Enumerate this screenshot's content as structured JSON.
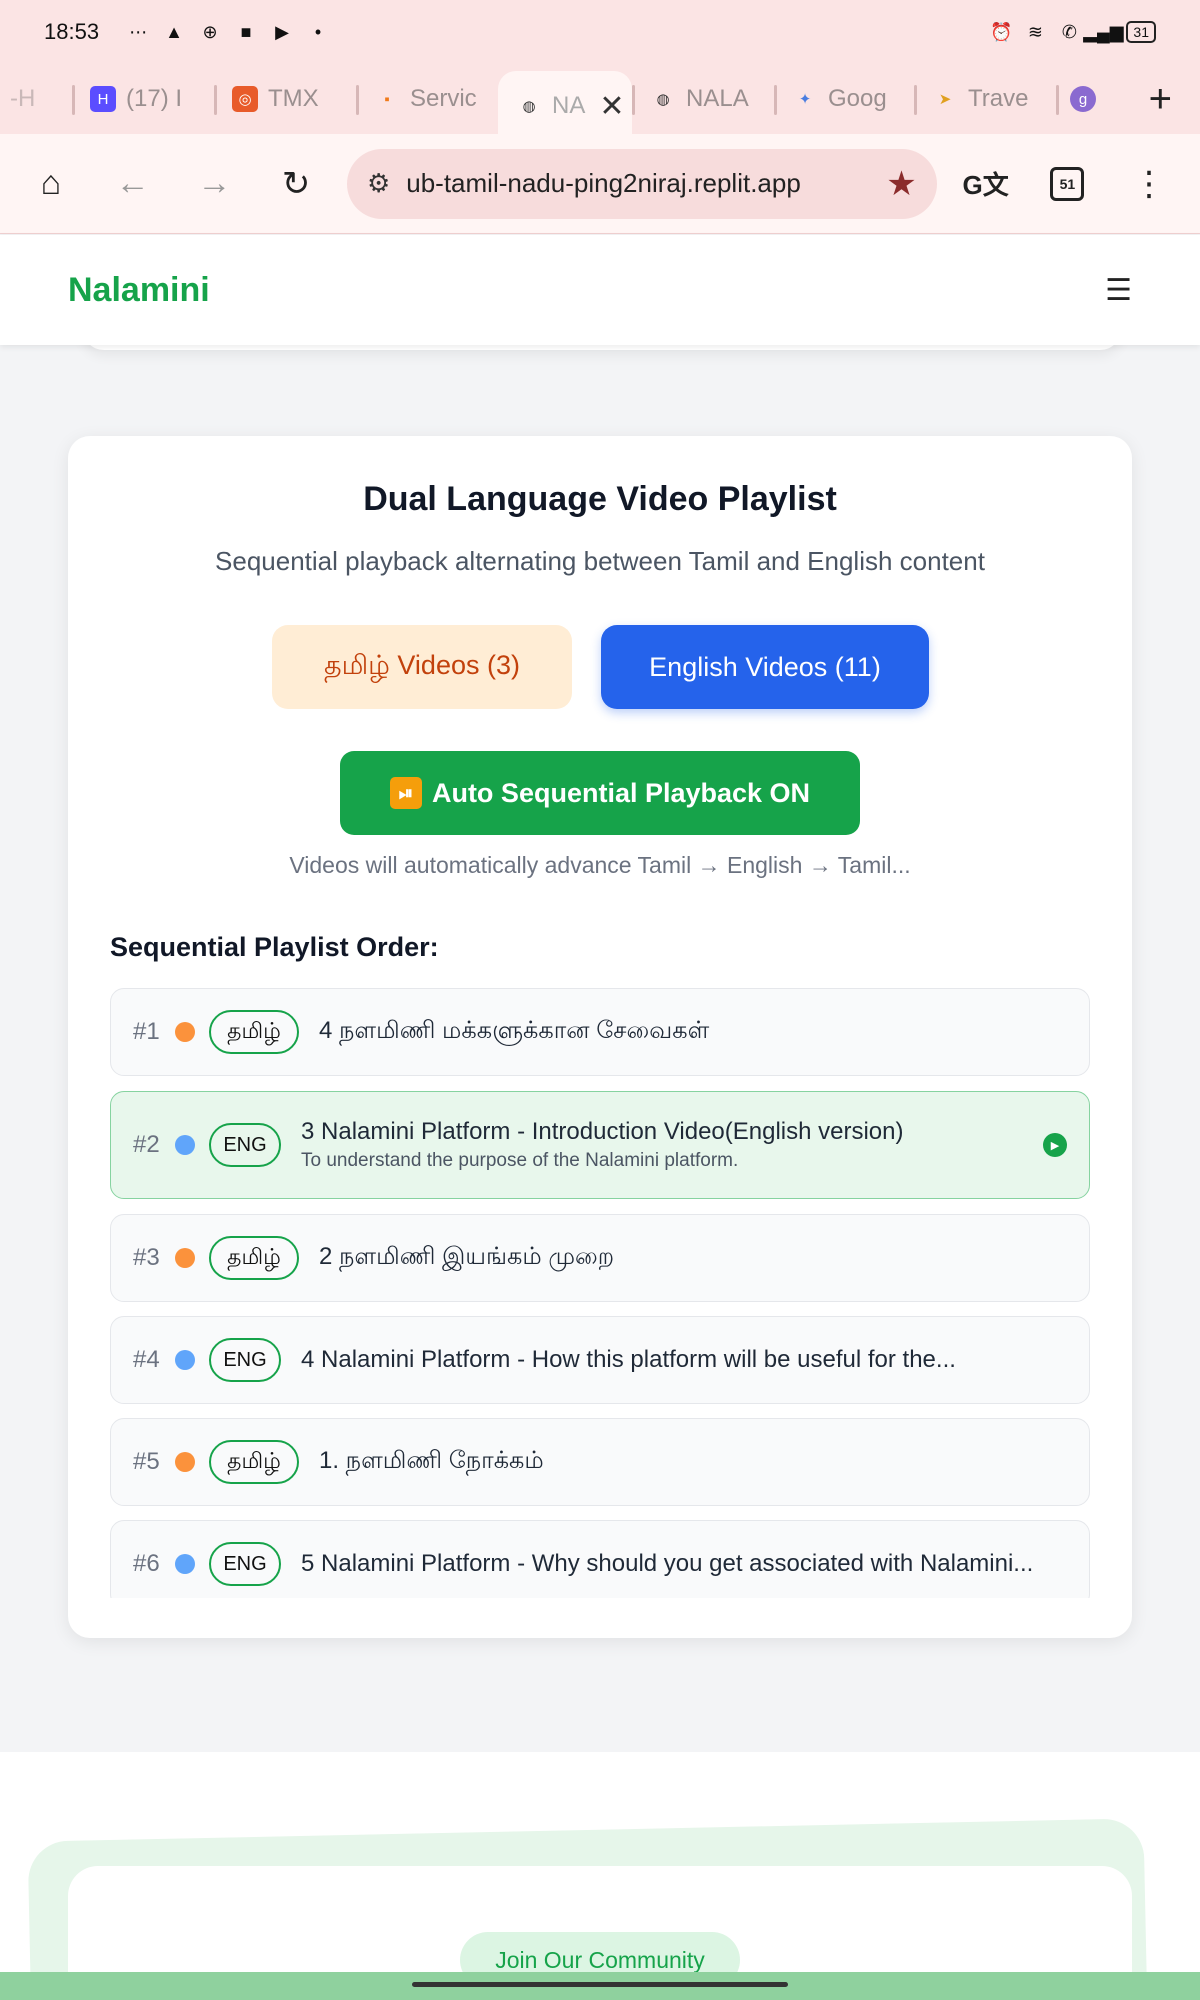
{
  "status_bar": {
    "time": "18:53",
    "battery": "31"
  },
  "tabs": [
    {
      "label": "(17) I",
      "favicon": "H",
      "color": "#5b4dff"
    },
    {
      "label": "TMX",
      "favicon": "◎",
      "color": "#e85b2a"
    },
    {
      "label": "Servic",
      "favicon": "▪",
      "color": "#f07a1a"
    },
    {
      "label": "NA",
      "favicon": "🌐",
      "color": "#333333",
      "active": true
    },
    {
      "label": "NALA",
      "favicon": "🌐",
      "color": "#333333"
    },
    {
      "label": "Goog",
      "favicon": "✦",
      "color": "#4a7de0"
    },
    {
      "label": "Trave",
      "favicon": "➤",
      "color": "#e0a020"
    },
    {
      "label": "",
      "favicon": "g",
      "color": "#8a6ad0"
    }
  ],
  "toolbar": {
    "url": "ub-tamil-nadu-ping2niraj.replit.app",
    "tab_count": "51"
  },
  "site": {
    "logo": "Nalamini"
  },
  "playlist": {
    "title": "Dual Language Video Playlist",
    "subtitle": "Sequential playback alternating between Tamil and English content",
    "tamil_button": "தமிழ் Videos (3)",
    "english_button": "English Videos (11)",
    "auto_button": "Auto Sequential Playback ON",
    "auto_note": "Videos will automatically advance Tamil → English → Tamil...",
    "order_heading": "Sequential Playlist Order:",
    "items": [
      {
        "num": "#1",
        "lang": "தமிழ்",
        "kind": "tamil",
        "title": "4 நளமிணி மக்களுக்கான சேவைகள்",
        "desc": ""
      },
      {
        "num": "#2",
        "lang": "ENG",
        "kind": "eng",
        "title": "3 Nalamini Platform - Introduction Video(English version)",
        "desc": "To understand the purpose of the Nalamini platform.",
        "active": true
      },
      {
        "num": "#3",
        "lang": "தமிழ்",
        "kind": "tamil",
        "title": "2 நளமிணி இயங்கம் முறை",
        "desc": ""
      },
      {
        "num": "#4",
        "lang": "ENG",
        "kind": "eng",
        "title": "4 Nalamini Platform - How this platform will be useful for the...",
        "desc": ""
      },
      {
        "num": "#5",
        "lang": "தமிழ்",
        "kind": "tamil",
        "title": "1. நளமிணி நோக்கம்",
        "desc": ""
      },
      {
        "num": "#6",
        "lang": "ENG",
        "kind": "eng",
        "title": "5 Nalamini Platform - Why should you get associated with Nalamini...",
        "desc": ""
      }
    ]
  },
  "community": {
    "join_label": "Join Our Community"
  },
  "colors": {
    "tamil_dot": "#fb923c",
    "eng_dot": "#60a5fa",
    "brand_green": "#16a34a",
    "primary_blue": "#2563eb"
  }
}
